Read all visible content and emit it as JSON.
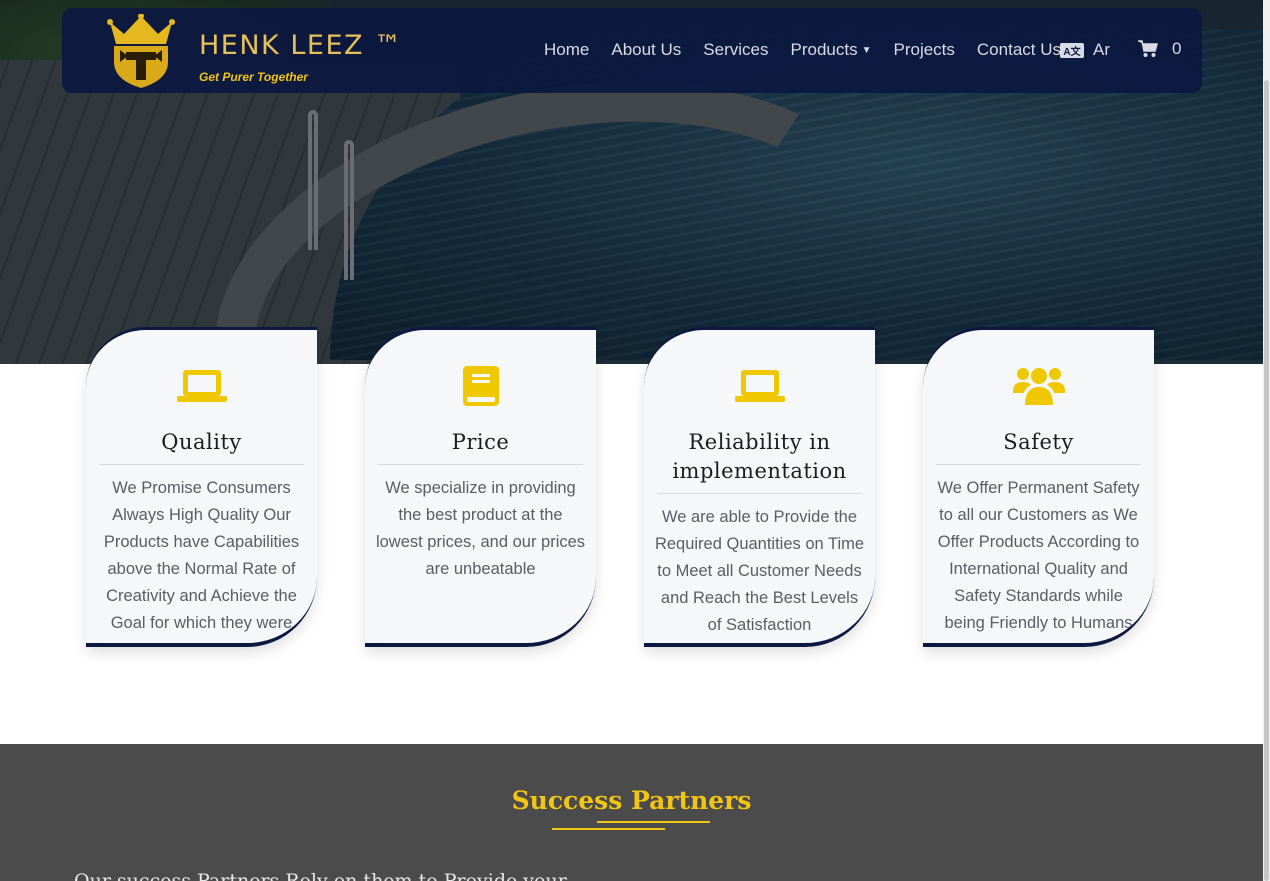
{
  "brand": {
    "name": "HENK LEEZ ™",
    "tagline": "Get Purer Together"
  },
  "nav": {
    "items": [
      "Home",
      "About Us",
      "Services",
      "Products",
      "Projects",
      "Contact Us"
    ],
    "language_label": "Ar",
    "language_icon": "language-icon",
    "cart_count": "0",
    "cart_icon": "cart-icon"
  },
  "features": [
    {
      "icon": "laptop-icon",
      "title": "Quality",
      "text": "We Promise Consumers Always High Quality Our Products have Capabilities above the Normal Rate of Creativity and Achieve the Goal for which they were"
    },
    {
      "icon": "book-icon",
      "title": "Price",
      "text": "We specialize in providing the best product at the lowest prices, and our prices are unbeatable"
    },
    {
      "icon": "laptop-icon",
      "title": "Reliability in implementation",
      "text": "We are able to Provide the Required Quantities on Time to Meet all Customer Needs and Reach the Best Levels of Satisfaction"
    },
    {
      "icon": "users-icon",
      "title": "Safety",
      "text": "We Offer Permanent Safety to all our Customers as We Offer Products According to International Quality and Safety Standards while being Friendly to Humans"
    }
  ],
  "partners": {
    "title": "Success Partners",
    "intro": "Our success Partners Rely on them to Provide your"
  },
  "colors": {
    "navy": "#0c1840",
    "gold": "#f2c514",
    "accent_icon": "#f0c800",
    "partners_bg": "#4b4b4b"
  }
}
